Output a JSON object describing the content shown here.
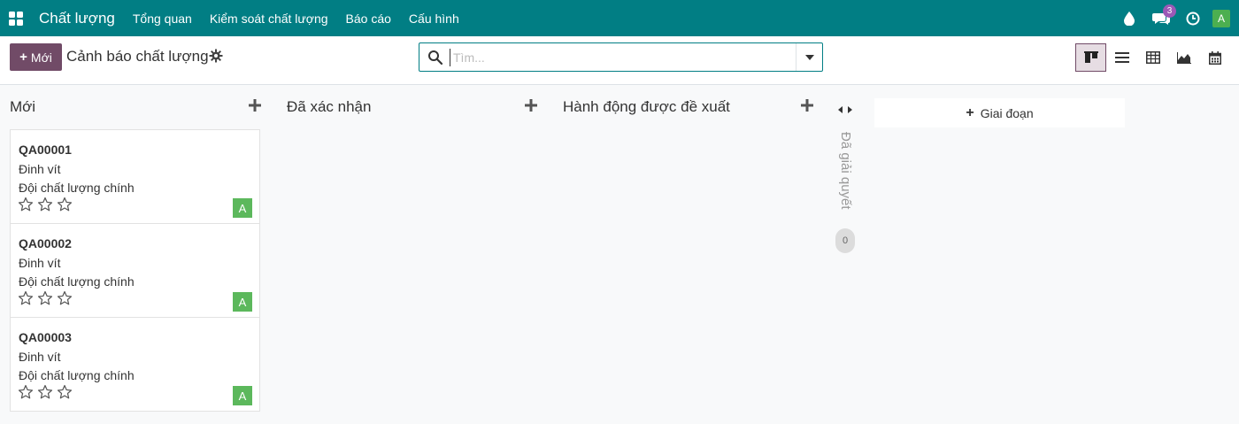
{
  "navbar": {
    "app_name": "Chất lượng",
    "menu": [
      "Tổng quan",
      "Kiểm soát chất lượng",
      "Báo cáo",
      "Cấu hình"
    ],
    "messages_count": "3",
    "user_initial": "A",
    "color": "#017e84"
  },
  "control": {
    "new_label": "Mới",
    "page_title": "Cảnh báo chất lượng",
    "search_placeholder": "Tìm...",
    "views": [
      "kanban-icon",
      "list-icon",
      "pivot-icon",
      "graph-icon",
      "calendar-icon"
    ],
    "active_view": "kanban",
    "accent_color": "#714b67"
  },
  "columns": [
    {
      "title": "Mới"
    },
    {
      "title": "Đã xác nhận"
    },
    {
      "title": "Hành động được đề xuất"
    }
  ],
  "cards": [
    {
      "ref": "QA00001",
      "product": "Đinh vít",
      "team": "Đội chất lượng chính",
      "avatar": "A",
      "stars": 0
    },
    {
      "ref": "QA00002",
      "product": "Đinh vít",
      "team": "Đội chất lượng chính",
      "avatar": "A",
      "stars": 0
    },
    {
      "ref": "QA00003",
      "product": "Đinh vít",
      "team": "Đội chất lượng chính",
      "avatar": "A",
      "stars": 0
    }
  ],
  "folded_column": {
    "title": "Đã giải quyết",
    "count": "0"
  },
  "add_stage_label": "Giai đoạn"
}
